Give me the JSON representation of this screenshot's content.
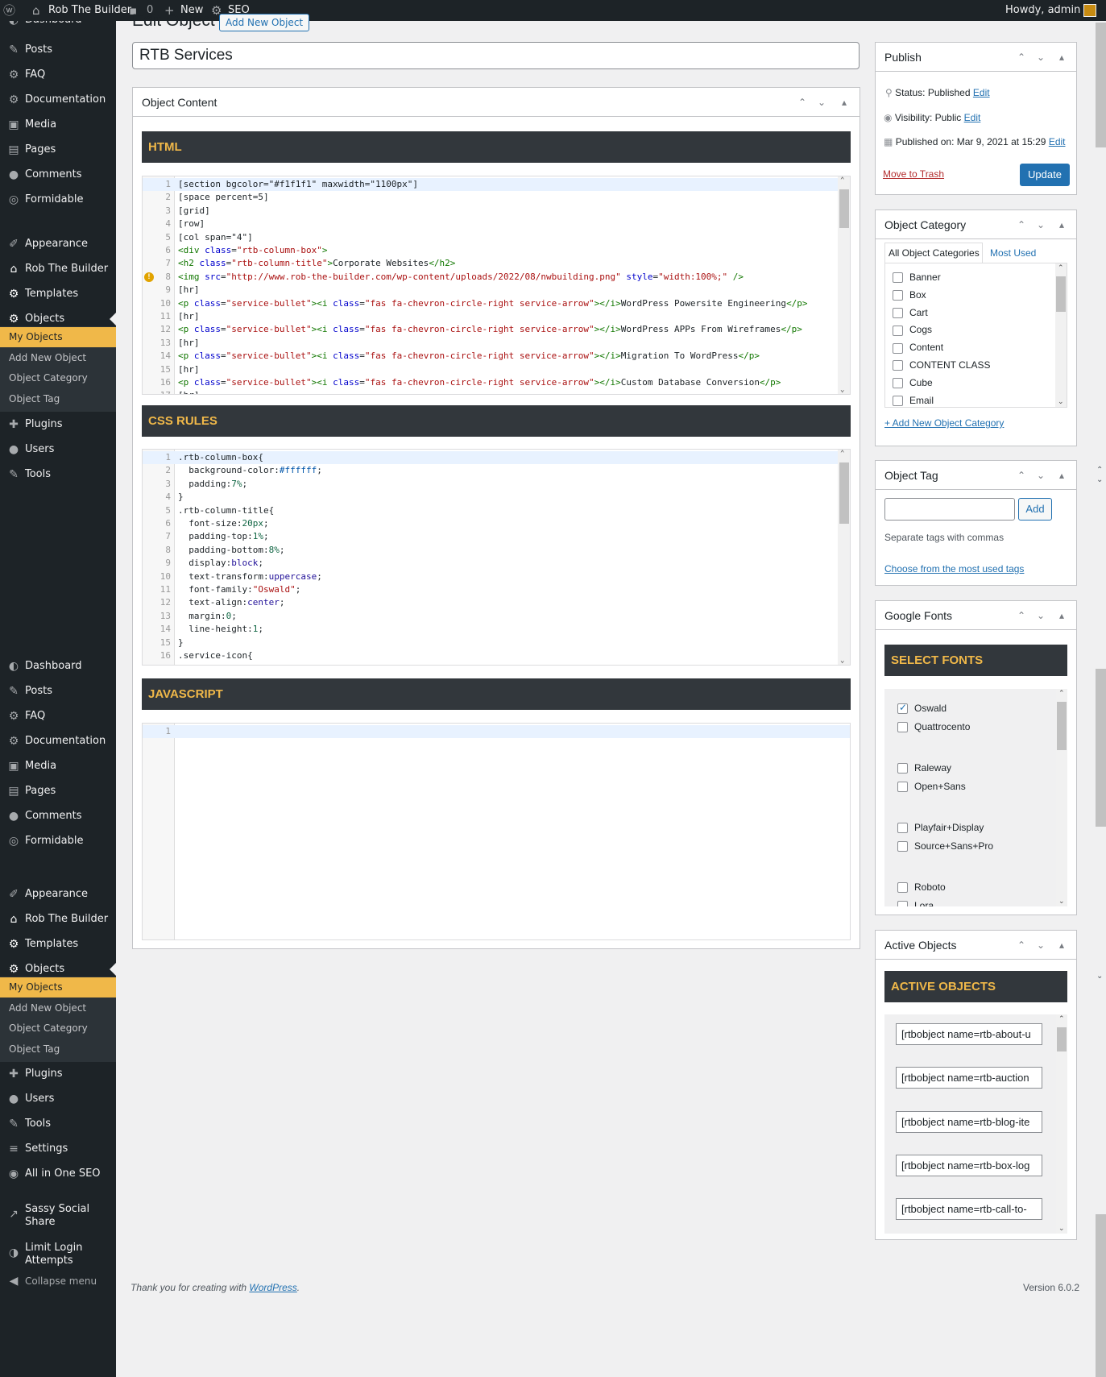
{
  "admin_bar": {
    "site_name": "Rob The Builder",
    "comments_count": "0",
    "new_label": "New",
    "seo_label": "SEO",
    "greeting": "Howdy, admin"
  },
  "menu": {
    "top_partial": "Dashboard",
    "items1": [
      {
        "icon": "✎",
        "label": "Posts"
      },
      {
        "icon": "⚙",
        "label": "FAQ"
      },
      {
        "icon": "⚙",
        "label": "Documentation"
      },
      {
        "icon": "▣",
        "label": "Media"
      },
      {
        "icon": "▤",
        "label": "Pages"
      },
      {
        "icon": "●",
        "label": "Comments"
      },
      {
        "icon": "◎",
        "label": "Formidable"
      }
    ],
    "items2": [
      {
        "icon": "✐",
        "label": "Appearance"
      },
      {
        "icon": "⌂",
        "label": "Rob The Builder"
      },
      {
        "icon": "⚙",
        "label": "Templates"
      },
      {
        "icon": "⚙",
        "label": "Objects"
      }
    ],
    "sub1": [
      "My Objects",
      "Add New Object",
      "Object Category",
      "Object Tag"
    ],
    "items3": [
      {
        "icon": "✚",
        "label": "Plugins"
      },
      {
        "icon": "●",
        "label": "Users"
      },
      {
        "icon": "✎",
        "label": "Tools"
      }
    ],
    "items4": [
      {
        "icon": "◐",
        "label": "Dashboard"
      },
      {
        "icon": "✎",
        "label": "Posts"
      },
      {
        "icon": "⚙",
        "label": "FAQ"
      },
      {
        "icon": "⚙",
        "label": "Documentation"
      },
      {
        "icon": "▣",
        "label": "Media"
      },
      {
        "icon": "▤",
        "label": "Pages"
      },
      {
        "icon": "●",
        "label": "Comments"
      },
      {
        "icon": "◎",
        "label": "Formidable"
      }
    ],
    "items5": [
      {
        "icon": "✐",
        "label": "Appearance"
      },
      {
        "icon": "⌂",
        "label": "Rob The Builder"
      },
      {
        "icon": "⚙",
        "label": "Templates"
      },
      {
        "icon": "⚙",
        "label": "Objects"
      }
    ],
    "sub2": [
      "My Objects",
      "Add New Object",
      "Object Category",
      "Object Tag"
    ],
    "items6": [
      {
        "icon": "✚",
        "label": "Plugins"
      },
      {
        "icon": "●",
        "label": "Users"
      },
      {
        "icon": "✎",
        "label": "Tools"
      },
      {
        "icon": "≡",
        "label": "Settings"
      },
      {
        "icon": "◉",
        "label": "All in One SEO"
      }
    ],
    "sassy_l1": "Sassy Social",
    "sassy_l2": "Share",
    "limit_l1": "Limit Login",
    "limit_l2": "Attempts",
    "collapse": "Collapse menu"
  },
  "page": {
    "title": "Edit Object",
    "add_new": "Add New Object",
    "post_title": "RTB Services"
  },
  "content_box": {
    "title": "Object Content",
    "html_label": "HTML",
    "css_label": "CSS RULES",
    "js_label": "JAVASCRIPT"
  },
  "publish": {
    "title": "Publish",
    "status": "Status: Published",
    "visibility": "Visibility: Public",
    "published_on": "Published on: Mar 9, 2021 at 15:29",
    "edit": "Edit",
    "trash": "Move to Trash",
    "update": "Update"
  },
  "category": {
    "title": "Object Category",
    "tab_all": "All Object Categories",
    "tab_used": "Most Used",
    "items": [
      "Banner",
      "Box",
      "Cart",
      "Cogs",
      "Content",
      "CONTENT CLASS",
      "Cube",
      "Email"
    ],
    "add_new": "+ Add New Object Category"
  },
  "tags": {
    "title": "Object Tag",
    "add": "Add",
    "hint": "Separate tags with commas",
    "choose": "Choose from the most used tags"
  },
  "fonts": {
    "title": "Google Fonts",
    "header": "SELECT FONTS",
    "items": [
      {
        "name": "Oswald",
        "checked": true
      },
      {
        "name": "Quattrocento",
        "checked": false
      },
      {
        "name": "Raleway",
        "checked": false
      },
      {
        "name": "Open+Sans",
        "checked": false
      },
      {
        "name": "Playfair+Display",
        "checked": false
      },
      {
        "name": "Source+Sans+Pro",
        "checked": false
      },
      {
        "name": "Roboto",
        "checked": false
      },
      {
        "name": "Lora",
        "checked": false
      }
    ]
  },
  "active": {
    "title": "Active Objects",
    "header": "ACTIVE OBJECTS",
    "items": [
      "[rtbobject name=rtb-about-u",
      "[rtbobject name=rtb-auction",
      "[rtbobject name=rtb-blog-ite",
      "[rtbobject name=rtb-box-log",
      "[rtbobject name=rtb-call-to-"
    ]
  },
  "footer": {
    "thanks": "Thank you for creating with ",
    "wp": "WordPress",
    "dot": ".",
    "version": "Version 6.0.2"
  }
}
